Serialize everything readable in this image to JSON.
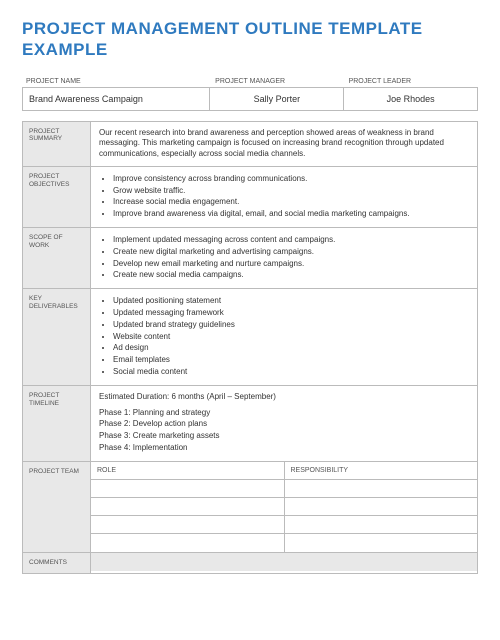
{
  "title": "PROJECT MANAGEMENT OUTLINE TEMPLATE EXAMPLE",
  "meta": {
    "labels": {
      "name": "PROJECT NAME",
      "manager": "PROJECT MANAGER",
      "leader": "PROJECT LEADER"
    },
    "values": {
      "name": "Brand Awareness Campaign",
      "manager": "Sally Porter",
      "leader": "Joe Rhodes"
    }
  },
  "sections": {
    "summary": {
      "label": "PROJECT SUMMARY",
      "text": "Our recent research into brand awareness and perception showed areas of weakness in brand messaging. This marketing campaign is focused on increasing brand recognition through updated communications, especially across social media channels."
    },
    "objectives": {
      "label": "PROJECT OBJECTIVES",
      "items": [
        "Improve consistency across branding communications.",
        "Grow website traffic.",
        "Increase social media engagement.",
        "Improve brand awareness via digital, email, and social media marketing campaigns."
      ]
    },
    "scope": {
      "label": "SCOPE OF WORK",
      "items": [
        "Implement updated messaging across content and campaigns.",
        "Create new digital marketing and advertising campaigns.",
        "Develop new email marketing and nurture campaigns.",
        "Create new social media campaigns."
      ]
    },
    "deliverables": {
      "label": "KEY DELIVERABLES",
      "items": [
        "Updated positioning statement",
        "Updated messaging framework",
        "Updated brand strategy guidelines",
        "Website content",
        "Ad design",
        "Email templates",
        "Social media content"
      ]
    },
    "timeline": {
      "label": "PROJECT TIMELINE",
      "duration": "Estimated Duration: 6 months (April – September)",
      "phases": [
        "Phase 1:  Planning and strategy",
        "Phase 2:  Develop action plans",
        "Phase 3:  Create marketing assets",
        "Phase 4:  Implementation"
      ]
    },
    "team": {
      "label": "PROJECT TEAM",
      "role_header": "ROLE",
      "resp_header": "RESPONSIBILITY",
      "rows": [
        {
          "role": "",
          "resp": ""
        },
        {
          "role": "",
          "resp": ""
        },
        {
          "role": "",
          "resp": ""
        },
        {
          "role": "",
          "resp": ""
        }
      ]
    },
    "comments": {
      "label": "COMMENTS"
    }
  }
}
